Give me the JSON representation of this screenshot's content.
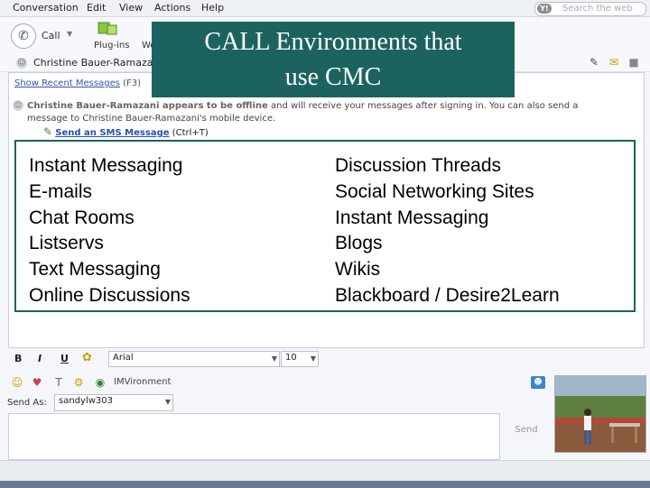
{
  "menubar": {
    "items": [
      "Conversation",
      "Edit",
      "View",
      "Actions",
      "Help"
    ]
  },
  "search": {
    "placeholder": "Search the web"
  },
  "toolbar": {
    "call_label": "Call",
    "plugins_label": "Plug-ins",
    "partial_label": "We"
  },
  "contact": {
    "name": "Christine Bauer-Ramazani"
  },
  "history": {
    "show_recent": "Show Recent Messages",
    "shortcut": "(F3)"
  },
  "offline_notice": {
    "bold_text": "Christine Bauer-Ramazani appears to be offline",
    "rest_text": " and will receive your messages after signing in. You can also send a message to Christine Bauer-Ramazani's mobile device."
  },
  "sms": {
    "link_text": "Send an SMS Message",
    "shortcut": "(Ctrl+T)"
  },
  "slide": {
    "title_line1": "CALL Environments that",
    "title_line2": "use CMC",
    "left_items": [
      "Instant Messaging",
      "E-mails",
      "Chat Rooms",
      "Listservs",
      "Text Messaging",
      "Online Discussions"
    ],
    "right_items": [
      "Discussion Threads",
      "Social Networking Sites",
      "Instant Messaging",
      "Blogs",
      "Wikis",
      "Blackboard / Desire2Learn"
    ]
  },
  "format": {
    "bold": "B",
    "italic": "I",
    "underline": "U",
    "font": "Arial",
    "size": "10"
  },
  "imvironment_label": "IMVironment",
  "send_as": {
    "label": "Send As:",
    "value": "sandylw303"
  },
  "send_label": "Send",
  "colors": {
    "title_bg": "#1c6360",
    "content_border": "#1c6360",
    "link": "#2750b0"
  }
}
